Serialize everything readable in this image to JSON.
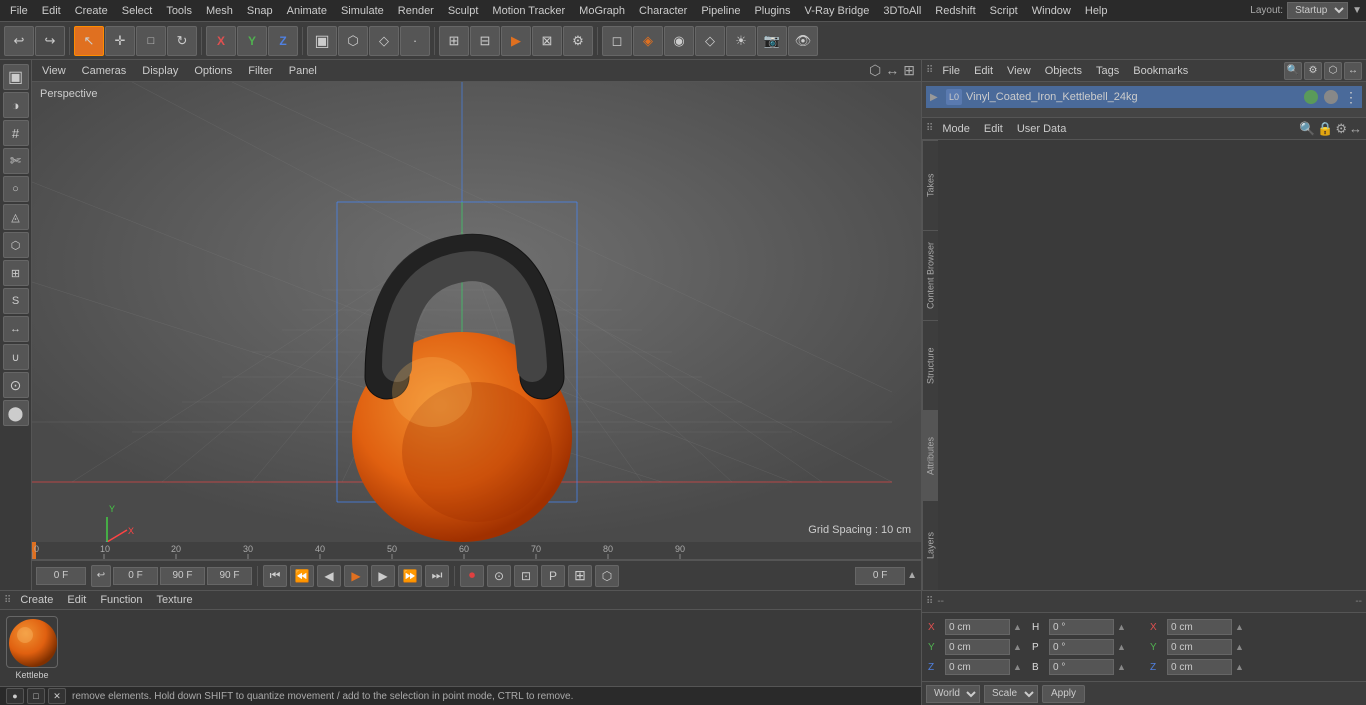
{
  "menubar": {
    "items": [
      "File",
      "Edit",
      "Create",
      "Select",
      "Tools",
      "Mesh",
      "Snap",
      "Animate",
      "Simulate",
      "Render",
      "Sculpt",
      "Motion Tracker",
      "MoGraph",
      "Character",
      "Pipeline",
      "Plugins",
      "V-Ray Bridge",
      "3DToAll",
      "Redshift",
      "Script",
      "Window",
      "Help"
    ],
    "layout_label": "Layout:",
    "layout_value": "Startup"
  },
  "top_toolbar": {
    "undo_icon": "↩",
    "redo_icon": "↪",
    "move_icon": "✛",
    "scale_icon": "⤢",
    "rotate_icon": "↻",
    "select_icon": "↖",
    "live_sel_icon": "◈",
    "x_axis": "X",
    "y_axis": "Y",
    "z_axis": "Z",
    "model_icon": "▣",
    "frame_icon": "▤",
    "anim_icon": "⏵"
  },
  "viewport": {
    "label": "Perspective",
    "menus": [
      "View",
      "Cameras",
      "Display",
      "Options",
      "Filter",
      "Panel"
    ],
    "grid_spacing": "Grid Spacing : 10 cm"
  },
  "object_manager": {
    "menus": [
      "File",
      "Edit",
      "View",
      "Objects",
      "Tags",
      "Bookmarks"
    ],
    "object_name": "Vinyl_Coated_Iron_Kettlebell_24kg",
    "search_icon": "🔍",
    "settings_icon": "⚙"
  },
  "attributes": {
    "menus": [
      "Mode",
      "Edit",
      "User Data"
    ],
    "mode_label": "Mode",
    "edit_label": "Edit",
    "user_data_label": "User Data"
  },
  "timeline": {
    "menus": [
      "Create",
      "Edit",
      "Function",
      "Texture"
    ],
    "ticks": [
      "0",
      "10",
      "20",
      "30",
      "40",
      "50",
      "60",
      "70",
      "80",
      "90"
    ],
    "tick_vals": [
      0,
      10,
      20,
      30,
      40,
      50,
      60,
      70,
      80,
      90
    ]
  },
  "playback": {
    "current_frame": "0 F",
    "start_frame": "0 F",
    "end_frame": "90 F",
    "end_frame2": "90 F",
    "frame_indicator": "0 F"
  },
  "material": {
    "name": "Kettlebe",
    "preview_color": "#e07020"
  },
  "coordinates": {
    "x_pos": "0 cm",
    "y_pos": "0 cm",
    "z_pos": "0 cm",
    "x_rot": "",
    "y_rot": "",
    "z_rot": "",
    "h_val": "0 °",
    "p_val": "0",
    "b_val": "0",
    "x_size": "0 cm",
    "y_size": "0 cm",
    "z_size": "0 cm",
    "pos_label": "X",
    "pos_label_y": "Y",
    "pos_label_z": "Z",
    "size_label_x": "X",
    "size_label_y": "Y",
    "size_label_z": "Z",
    "rot_label_h": "H",
    "rot_label_p": "P",
    "rot_label_b": "B",
    "world_label": "World",
    "scale_label": "Scale",
    "apply_label": "Apply"
  },
  "status_bar": {
    "message": "remove elements. Hold down SHIFT to quantize movement / add to the selection in point mode, CTRL to remove.",
    "icon1": "●",
    "icon2": "□",
    "icon3": "✕"
  },
  "right_tabs": {
    "tabs": [
      "Takes",
      "Content Browser",
      "Structure",
      "Attributes",
      "Layers"
    ]
  }
}
